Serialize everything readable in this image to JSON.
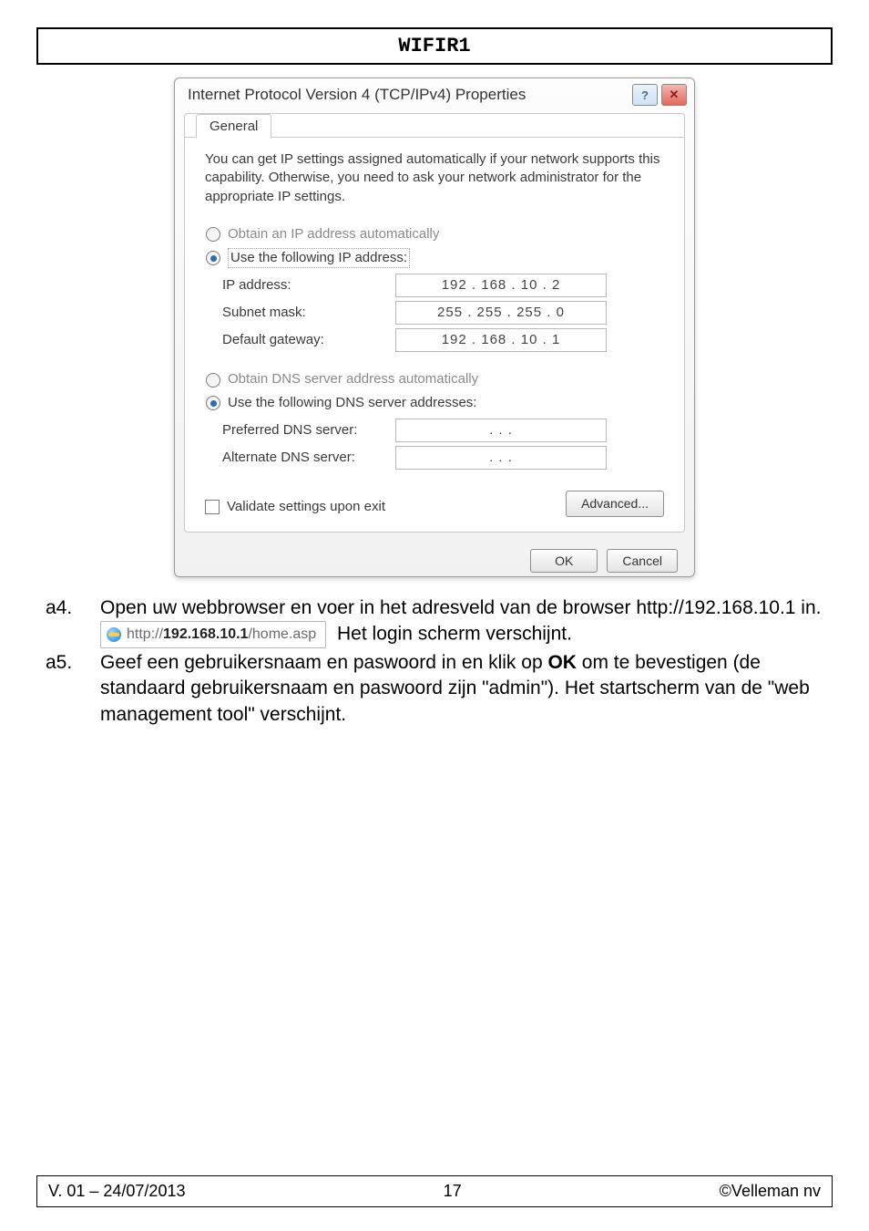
{
  "header": "WIFIR1",
  "dialog": {
    "title": "Internet Protocol Version 4 (TCP/IPv4) Properties",
    "help_glyph": "?",
    "close_glyph": "✕",
    "tab": "General",
    "description": "You can get IP settings assigned automatically if your network supports this capability. Otherwise, you need to ask your network administrator for the appropriate IP settings.",
    "radio_ip_auto": "Obtain an IP address automatically",
    "radio_ip_manual": "Use the following IP address:",
    "fields": {
      "ip_label": "IP address:",
      "ip_value": "192 . 168 .  10  .   2",
      "mask_label": "Subnet mask:",
      "mask_value": "255 . 255 . 255 .   0",
      "gw_label": "Default gateway:",
      "gw_value": "192 . 168 .  10  .   1"
    },
    "radio_dns_auto": "Obtain DNS server address automatically",
    "radio_dns_manual": "Use the following DNS server addresses:",
    "dns": {
      "pref_label": "Preferred DNS server:",
      "pref_value": ".       .       .",
      "alt_label": "Alternate DNS server:",
      "alt_value": ".       .       ."
    },
    "validate": "Validate settings upon exit",
    "advanced": "Advanced...",
    "ok": "OK",
    "cancel": "Cancel"
  },
  "steps": {
    "a4_num": "a4.",
    "a4_text": "Open uw webbrowser en voer in het adresveld van de browser http://192.168.10.1 in.",
    "addr_prefix": "http://",
    "addr_bold": "192.168.10.1",
    "addr_suffix": "/home.asp",
    "a4_tail": " Het login scherm verschijnt.",
    "a5_num": "a5.",
    "a5_before": "Geef een gebruikersnaam en paswoord in en klik op ",
    "a5_bold": "OK",
    "a5_after": " om te bevestigen (de standaard gebruikersnaam en paswoord zijn \"admin\"). Het startscherm van de \"web management tool\" verschijnt."
  },
  "footer": {
    "left": "V. 01 – 24/07/2013",
    "center": "17",
    "right": "©Velleman nv"
  }
}
